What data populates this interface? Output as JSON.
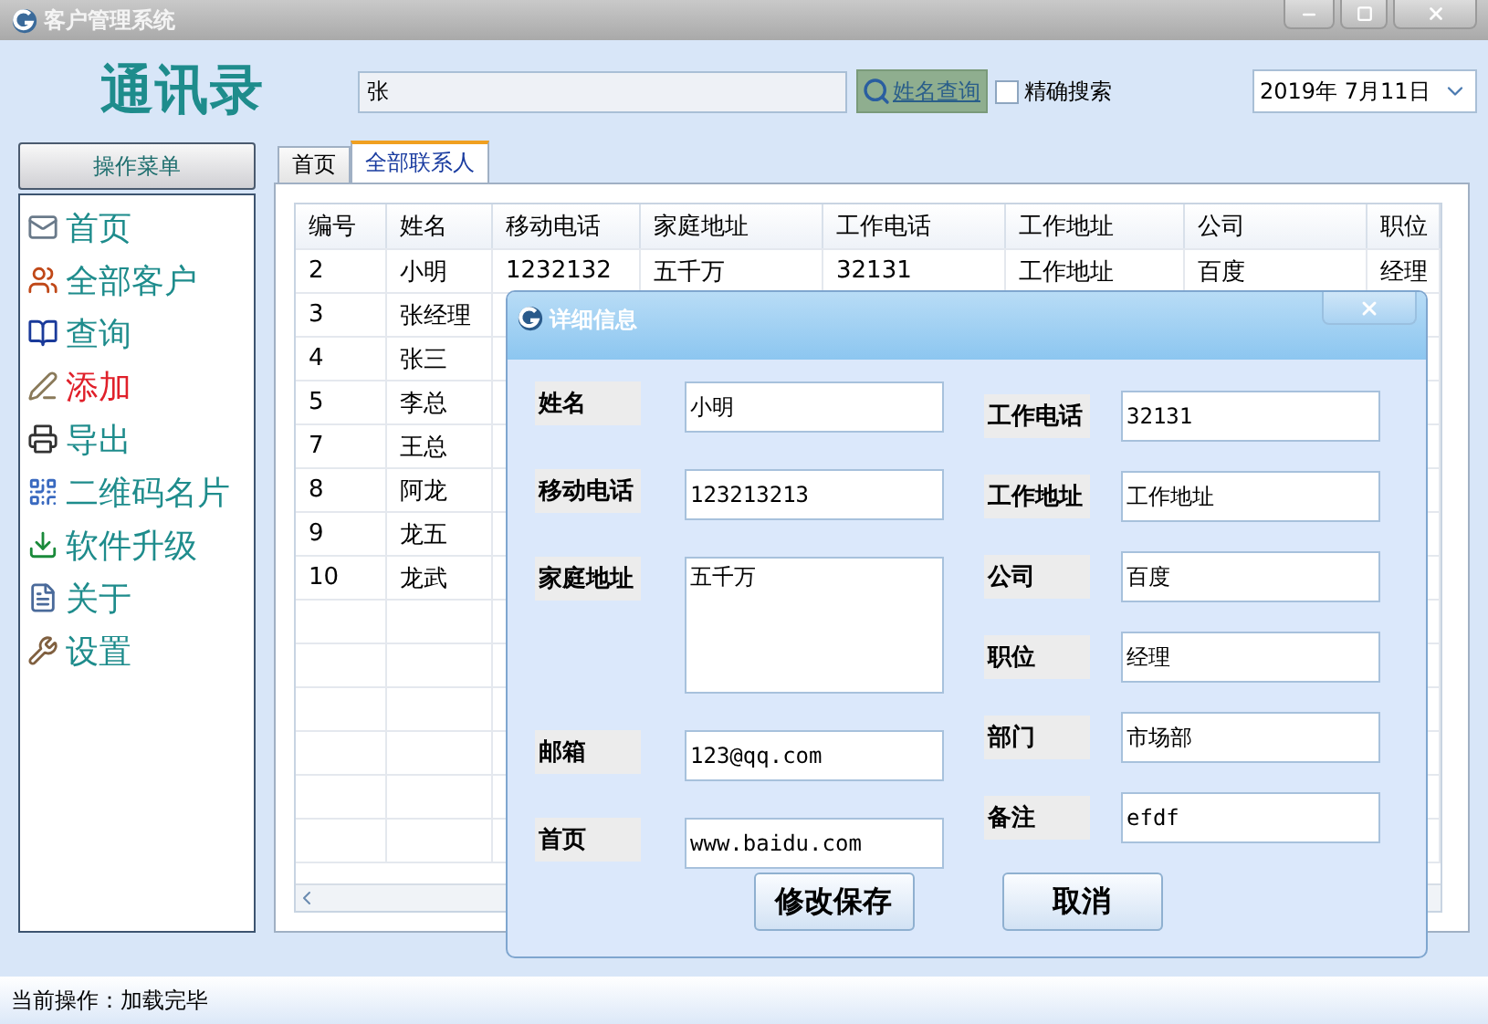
{
  "window": {
    "title": "客户管理系统"
  },
  "header": {
    "title": "通讯录",
    "search": {
      "value": "张"
    },
    "search_button": "姓名查询",
    "exact_search": {
      "label": "精确搜索",
      "checked": false
    },
    "date": "2019年  7月11日"
  },
  "sidebar": {
    "title": "操作菜单",
    "items": [
      {
        "label": "首页",
        "selected": false
      },
      {
        "label": "全部客户",
        "selected": false
      },
      {
        "label": "查询",
        "selected": false
      },
      {
        "label": "添加",
        "selected": true
      },
      {
        "label": "导出",
        "selected": false
      },
      {
        "label": "二维码名片",
        "selected": false
      },
      {
        "label": "软件升级",
        "selected": false
      },
      {
        "label": "关于",
        "selected": false
      },
      {
        "label": "设置",
        "selected": false
      }
    ]
  },
  "tabs": [
    {
      "label": "首页",
      "selected": false
    },
    {
      "label": "全部联系人",
      "selected": true
    }
  ],
  "table": {
    "columns": [
      "编号",
      "姓名",
      "移动电话",
      "家庭地址",
      "工作电话",
      "工作地址",
      "公司",
      "职位"
    ],
    "rows": [
      [
        "2",
        "小明",
        "1232132",
        "五千万",
        "32131",
        "工作地址",
        "百度",
        "经理"
      ],
      [
        "3",
        "张经理"
      ],
      [
        "4",
        "张三"
      ],
      [
        "5",
        "李总"
      ],
      [
        "7",
        "王总"
      ],
      [
        "8",
        "阿龙"
      ],
      [
        "9",
        "龙五"
      ],
      [
        "10",
        "龙武"
      ]
    ]
  },
  "dialog": {
    "title": "详细信息",
    "left_fields": [
      {
        "label": "姓名",
        "value": "小明",
        "kind": "text"
      },
      {
        "label": "移动电话",
        "value": "123213213",
        "kind": "text"
      },
      {
        "label": "家庭地址",
        "value": "五千万",
        "kind": "multiline"
      },
      {
        "label": "邮箱",
        "value": "123@qq.com",
        "kind": "text"
      },
      {
        "label": "首页",
        "value": "www.baidu.com",
        "kind": "text"
      }
    ],
    "right_fields": [
      {
        "label": "工作电话",
        "value": "32131",
        "kind": "text"
      },
      {
        "label": "工作地址",
        "value": "工作地址",
        "kind": "text"
      },
      {
        "label": "公司",
        "value": "百度",
        "kind": "text"
      },
      {
        "label": "职位",
        "value": "经理",
        "kind": "text"
      },
      {
        "label": "部门",
        "value": "市场部",
        "kind": "text"
      },
      {
        "label": "备注",
        "value": "efdf",
        "kind": "text"
      }
    ],
    "buttons": [
      "修改保存",
      "取消"
    ]
  },
  "status_bar": "当前操作：加载完毕"
}
